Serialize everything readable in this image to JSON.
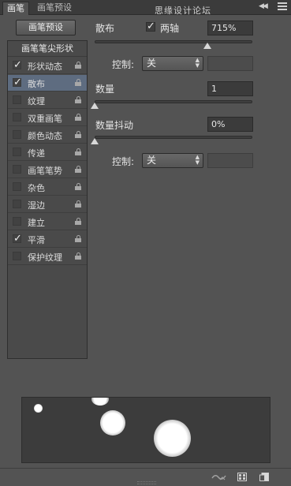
{
  "tabs": [
    {
      "label": "画笔",
      "active": true
    },
    {
      "label": "画笔预设",
      "active": false
    }
  ],
  "watermark": "思缘设计论坛",
  "preset_button": "画笔预设",
  "list": {
    "header": "画笔笔尖形状",
    "items": [
      {
        "label": "形状动态",
        "checked": true,
        "selected": false
      },
      {
        "label": "散布",
        "checked": true,
        "selected": true
      },
      {
        "label": "纹理",
        "checked": false,
        "selected": false
      },
      {
        "label": "双重画笔",
        "checked": false,
        "selected": false
      },
      {
        "label": "颜色动态",
        "checked": false,
        "selected": false
      },
      {
        "label": "传递",
        "checked": false,
        "selected": false
      },
      {
        "label": "画笔笔势",
        "checked": false,
        "selected": false
      },
      {
        "label": "杂色",
        "checked": false,
        "selected": false
      },
      {
        "label": "湿边",
        "checked": false,
        "selected": false
      },
      {
        "label": "建立",
        "checked": false,
        "selected": false
      },
      {
        "label": "平滑",
        "checked": true,
        "selected": false
      },
      {
        "label": "保护纹理",
        "checked": false,
        "selected": false
      }
    ]
  },
  "scatter": {
    "label": "散布",
    "both_axes_label": "两轴",
    "both_axes_checked": true,
    "value": "715%",
    "slider_fraction": 0.71,
    "control_label": "控制:",
    "control_value": "关"
  },
  "count": {
    "label": "数量",
    "value": "1",
    "slider_fraction": 0.0
  },
  "count_jitter": {
    "label": "数量抖动",
    "value": "0%",
    "slider_fraction": 0.0,
    "control_label": "控制:",
    "control_value": "关"
  },
  "check_glyph": "✓"
}
